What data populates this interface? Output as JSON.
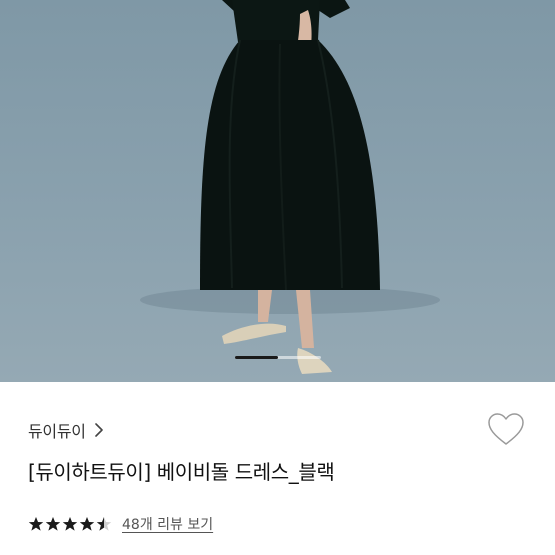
{
  "product": {
    "brand": "듀이듀이",
    "title": "[듀이하트듀이] 베이비돌 드레스_블랙",
    "rating": 4.5,
    "rating_max": 5,
    "review_link": "48개 리뷰 보기"
  },
  "gallery": {
    "current_slide_fraction": 0.5,
    "photo_description_icon": "dress-photo"
  },
  "icons": {
    "brand_chevron": "chevron-right-icon",
    "wishlist": "heart-outline-icon",
    "star": "star-icon"
  },
  "colors": {
    "background": "#ffffff",
    "text_primary": "#111111",
    "text_secondary": "#555555",
    "star": "#1a1a1a",
    "photo_backdrop": "#8aa1ae"
  }
}
